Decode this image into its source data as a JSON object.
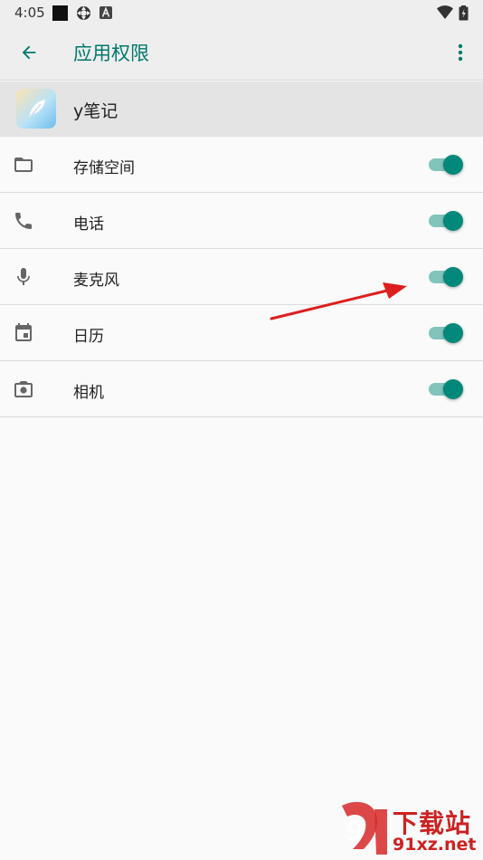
{
  "status_bar": {
    "time": "4:05",
    "icons": [
      "square-icon",
      "sync-icon",
      "a-icon",
      "wifi-icon",
      "battery-icon"
    ]
  },
  "app_bar": {
    "title": "应用权限",
    "back_icon": "arrow-back-icon",
    "more_icon": "more-vert-icon"
  },
  "app": {
    "name": "y笔记",
    "icon": "feather-icon"
  },
  "permissions": [
    {
      "label": "存储空间",
      "icon": "folder-icon",
      "enabled": true
    },
    {
      "label": "电话",
      "icon": "phone-icon",
      "enabled": true
    },
    {
      "label": "麦克风",
      "icon": "microphone-icon",
      "enabled": true
    },
    {
      "label": "日历",
      "icon": "calendar-icon",
      "enabled": true
    },
    {
      "label": "相机",
      "icon": "camera-icon",
      "enabled": true
    }
  ],
  "colors": {
    "accent": "#00796b",
    "toggle_thumb": "#00897b",
    "toggle_track": "#80c4bc",
    "annotation": "#dd1f1f"
  },
  "watermark": {
    "title": "下载站",
    "subtitle": "91xz.net"
  }
}
